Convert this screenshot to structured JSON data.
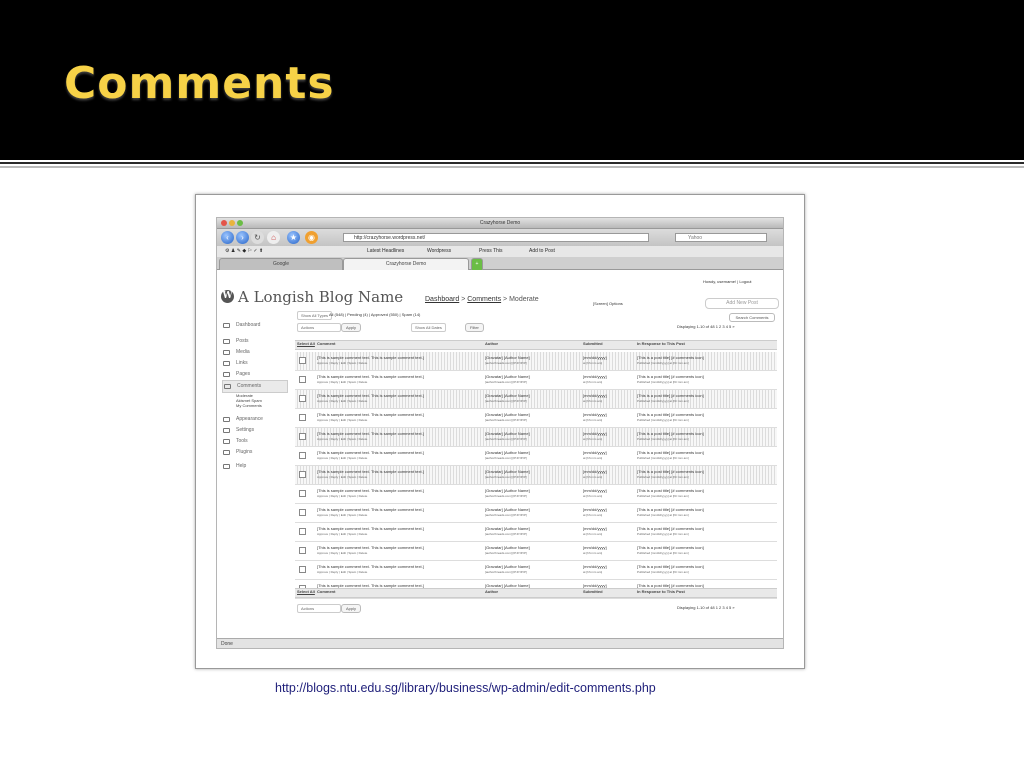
{
  "slide": {
    "title": "Comments",
    "caption_url": "http://blogs.ntu.edu.sg/library/business/wp-admin/edit-comments.php",
    "title_color": "#f7d247"
  },
  "browser": {
    "window_title": "Crazyhorse Demo",
    "url": "http://crazyhorse.wordpress.net/",
    "search_placeholder": "Yahoo",
    "bookmarks": [
      "Latest Headlines",
      "Wordpress",
      "Press This",
      "Add to Post"
    ],
    "tabs": [
      {
        "label": "Google"
      },
      {
        "label": "Crazyhorse Demo"
      }
    ],
    "status": "Done"
  },
  "wp": {
    "blog_name": "A Longish Blog Name",
    "breadcrumb": {
      "dashboard": "Dashboard",
      "comments": "Comments",
      "current": "Moderate"
    },
    "sep": ">",
    "howdy": "Howdy, username! | Logout",
    "screen_options": "[Screen] Options",
    "add_new_post": "Add New Post",
    "menu": [
      {
        "label": "Dashboard",
        "icon": "dashboard-icon"
      },
      {
        "label": "Posts",
        "icon": "posts-icon"
      },
      {
        "label": "Media",
        "icon": "media-icon"
      },
      {
        "label": "Links",
        "icon": "links-icon"
      },
      {
        "label": "Pages",
        "icon": "pages-icon"
      },
      {
        "label": "Comments",
        "icon": "comments-icon"
      },
      {
        "label": "Appearance",
        "icon": "appearance-icon"
      },
      {
        "label": "Settings",
        "icon": "settings-icon"
      },
      {
        "label": "Tools",
        "icon": "tools-icon"
      },
      {
        "label": "Plugins",
        "icon": "plugins-icon"
      },
      {
        "label": "Help",
        "icon": "help-icon"
      }
    ],
    "comments_submenu": [
      "Moderate",
      "Akismet Spam",
      "My Comments"
    ],
    "filters": {
      "show_types": "Show All Types",
      "status_links": "All (548) | Pending (4) | Approved (550) | Spam (14)",
      "show_dates": "Show All Dates",
      "filter_button": "Filter",
      "actions": "Actions",
      "apply": "Apply",
      "search_button": "Search Comments"
    },
    "paging": {
      "text": "Displaying 1-10 of 48",
      "pages": "1 2 3 4 5 »"
    },
    "columns": [
      "Select All",
      "Comment",
      "Author",
      "Submitted",
      "In Response to This Post"
    ],
    "row_template": {
      "comment": "[This is sample comment text. This is sample comment text.]",
      "comment_actions": "Approve | Reply | Edit | Spam | Delete",
      "author": "[Gravatar] [Author Name]",
      "author_sub": "[authorthreads.com] [IP.IP.IP.IP]",
      "submitted": "[mm/dd/yyyy]",
      "submitted_sub": "at [hh:mm am]",
      "post": "[This is a post title]   [# comments icon]",
      "post_sub": "Published [mm/dd/yyyy] at [hh:mm am]"
    },
    "row_count": 13,
    "alt_rows": [
      0,
      2,
      4,
      6
    ]
  }
}
